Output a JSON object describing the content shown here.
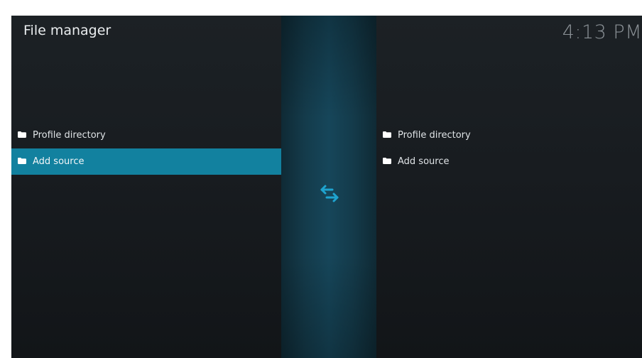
{
  "window": {
    "title": "File manager",
    "clock": "4:13 PM"
  },
  "left_pane": {
    "items": [
      {
        "label": "Profile directory",
        "icon": "folder-icon",
        "focused": false
      },
      {
        "label": "Add source",
        "icon": "folder-icon",
        "focused": true
      }
    ]
  },
  "right_pane": {
    "items": [
      {
        "label": "Profile directory",
        "icon": "folder-icon",
        "focused": false
      },
      {
        "label": "Add source",
        "icon": "folder-icon",
        "focused": false
      }
    ]
  },
  "center": {
    "icon": "swap-arrows-icon"
  },
  "colors": {
    "accent": "#12819f",
    "swap_icon": "#1fa3cf",
    "background": "#1c2125",
    "text": "#dfe3e6",
    "clock": "#8a9095"
  }
}
